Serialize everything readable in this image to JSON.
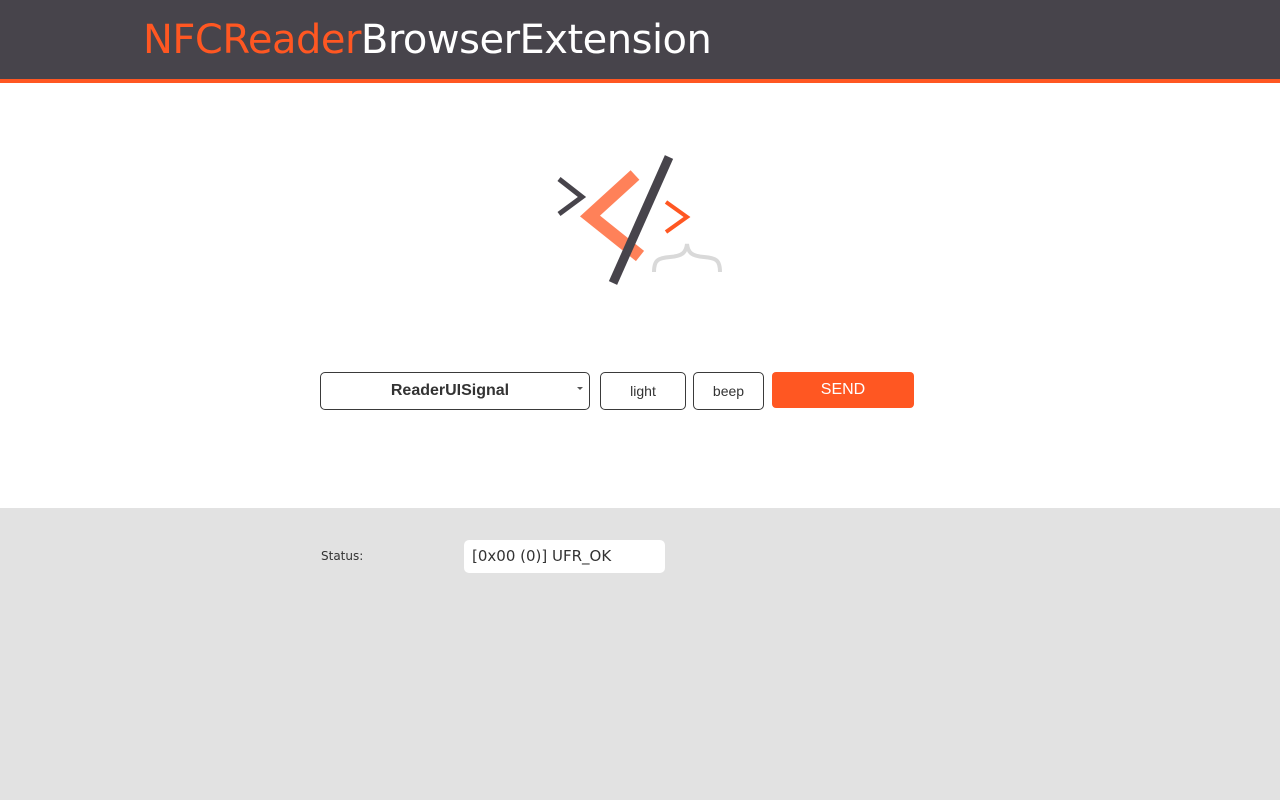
{
  "header": {
    "title_accent": "NFCReader",
    "title_rest": "BrowserExtension"
  },
  "colors": {
    "accent": "#ff5722",
    "header_bg": "#47444b",
    "footer_bg": "#e2e2e2"
  },
  "logo": {
    "icon": "code-brackets-logo-icon"
  },
  "controls": {
    "command_select": {
      "selected": "ReaderUISignal"
    },
    "param_light": "light",
    "param_beep": "beep",
    "send_label": "SEND"
  },
  "status": {
    "label": "Status:",
    "value": "[0x00 (0)] UFR_OK"
  }
}
